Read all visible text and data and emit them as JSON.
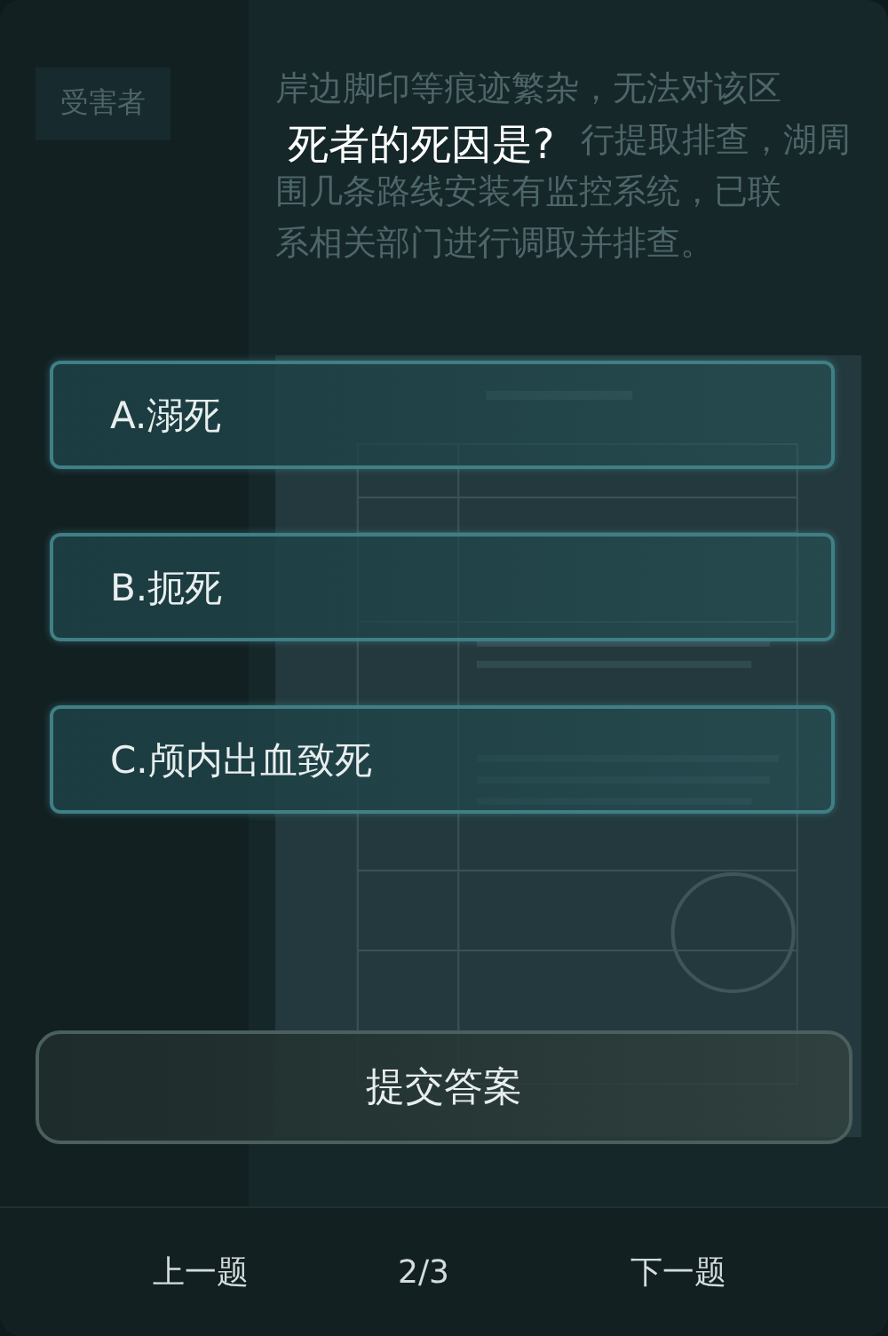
{
  "sidebar": {
    "tab": "受害者"
  },
  "background_text": {
    "lines": [
      "岸边脚印等痕迹繁杂，无法对该区",
      "行提取排查，湖周",
      "围几条路线安装有监控系统，已联",
      "系相关部门进行调取并排查。"
    ]
  },
  "question": "死者的死因是?",
  "options": [
    {
      "label": "A.溺死",
      "selected": false
    },
    {
      "label": "B.扼死",
      "selected": false
    },
    {
      "label": "C.颅内出血致死",
      "selected": false
    }
  ],
  "submit_button": "提交答案",
  "footer": {
    "prev": "上一题",
    "page": "2/3",
    "next": "下一题"
  }
}
